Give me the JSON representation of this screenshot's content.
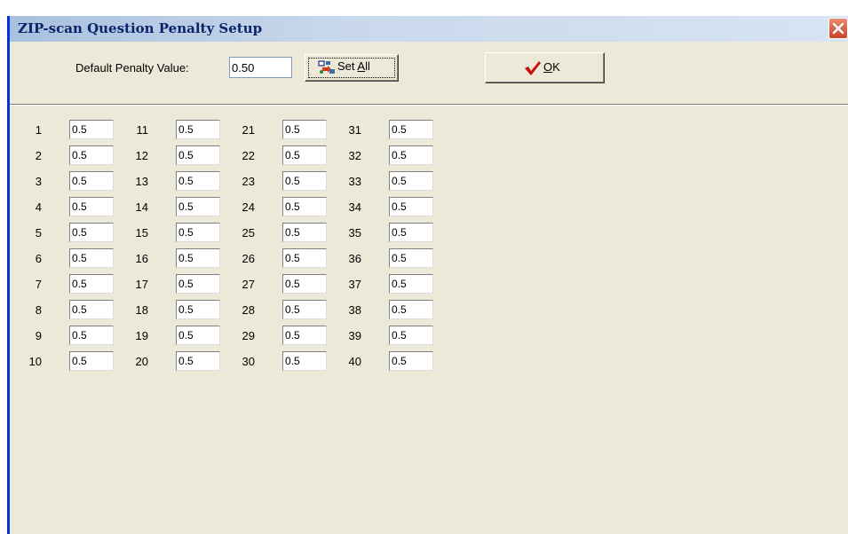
{
  "window": {
    "title": "ZIP-scan Question Penalty Setup"
  },
  "toolbar": {
    "default_label": "Default Penalty Value:",
    "default_value": "0.50",
    "set_all_prefix": "Set ",
    "set_all_mnemonic": "A",
    "set_all_suffix": "ll",
    "ok_mnemonic": "O",
    "ok_suffix": "K"
  },
  "questions": [
    {
      "num": "1",
      "value": "0.5"
    },
    {
      "num": "2",
      "value": "0.5"
    },
    {
      "num": "3",
      "value": "0.5"
    },
    {
      "num": "4",
      "value": "0.5"
    },
    {
      "num": "5",
      "value": "0.5"
    },
    {
      "num": "6",
      "value": "0.5"
    },
    {
      "num": "7",
      "value": "0.5"
    },
    {
      "num": "8",
      "value": "0.5"
    },
    {
      "num": "9",
      "value": "0.5"
    },
    {
      "num": "10",
      "value": "0.5"
    },
    {
      "num": "11",
      "value": "0.5"
    },
    {
      "num": "12",
      "value": "0.5"
    },
    {
      "num": "13",
      "value": "0.5"
    },
    {
      "num": "14",
      "value": "0.5"
    },
    {
      "num": "15",
      "value": "0.5"
    },
    {
      "num": "16",
      "value": "0.5"
    },
    {
      "num": "17",
      "value": "0.5"
    },
    {
      "num": "18",
      "value": "0.5"
    },
    {
      "num": "19",
      "value": "0.5"
    },
    {
      "num": "20",
      "value": "0.5"
    },
    {
      "num": "21",
      "value": "0.5"
    },
    {
      "num": "22",
      "value": "0.5"
    },
    {
      "num": "23",
      "value": "0.5"
    },
    {
      "num": "24",
      "value": "0.5"
    },
    {
      "num": "25",
      "value": "0.5"
    },
    {
      "num": "26",
      "value": "0.5"
    },
    {
      "num": "27",
      "value": "0.5"
    },
    {
      "num": "28",
      "value": "0.5"
    },
    {
      "num": "29",
      "value": "0.5"
    },
    {
      "num": "30",
      "value": "0.5"
    },
    {
      "num": "31",
      "value": "0.5"
    },
    {
      "num": "32",
      "value": "0.5"
    },
    {
      "num": "33",
      "value": "0.5"
    },
    {
      "num": "34",
      "value": "0.5"
    },
    {
      "num": "35",
      "value": "0.5"
    },
    {
      "num": "36",
      "value": "0.5"
    },
    {
      "num": "37",
      "value": "0.5"
    },
    {
      "num": "38",
      "value": "0.5"
    },
    {
      "num": "39",
      "value": "0.5"
    },
    {
      "num": "40",
      "value": "0.5"
    }
  ]
}
